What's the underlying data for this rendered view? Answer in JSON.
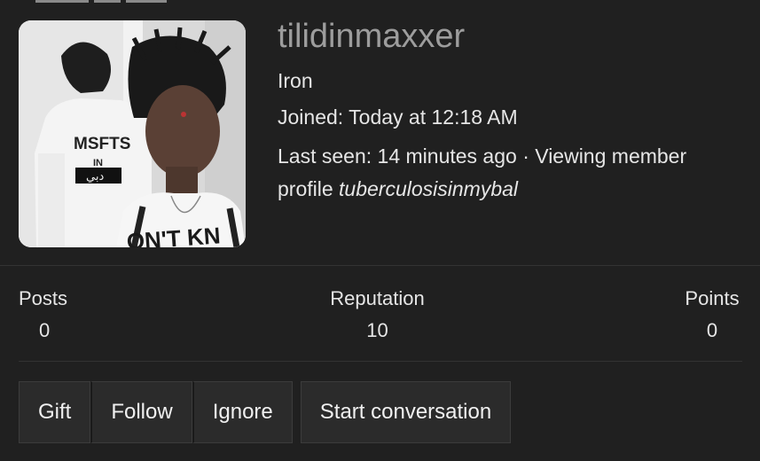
{
  "profile": {
    "username": "tilidinmaxxer",
    "rank": "Iron",
    "joined_label": "Joined:",
    "joined_value": "Today at 12:18 AM",
    "last_seen_label": "Last seen:",
    "last_seen_value": "14 minutes ago",
    "separator": "·",
    "activity_text": "Viewing member profile",
    "activity_target": "tuberculosisinmybal",
    "avatar_shirt_text_back": "MSFTS",
    "avatar_shirt_text_back_2": "IN",
    "avatar_shirt_text_back_3": "دبي",
    "avatar_shirt_text_front": "ON'T KN"
  },
  "stats": {
    "posts_label": "Posts",
    "posts_value": "0",
    "reputation_label": "Reputation",
    "reputation_value": "10",
    "points_label": "Points",
    "points_value": "0"
  },
  "actions": {
    "gift": "Gift",
    "follow": "Follow",
    "ignore": "Ignore",
    "start_conversation": "Start conversation"
  },
  "colors": {
    "background": "#202020",
    "username": "#9d9d9d",
    "text": "#e6e6e6",
    "button_bg": "#2b2b2b"
  }
}
